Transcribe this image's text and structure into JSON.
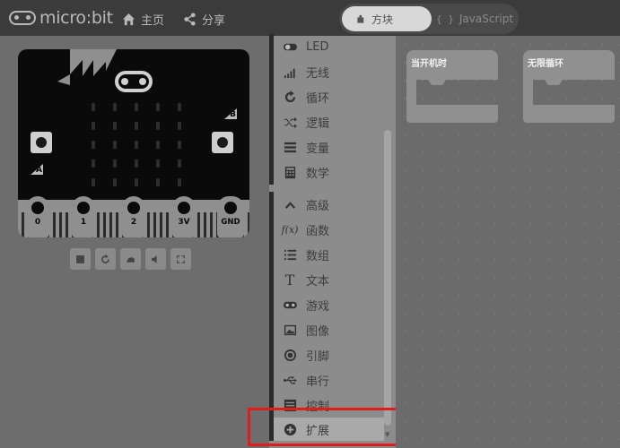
{
  "header": {
    "logo_text": "micro:bit",
    "nav": [
      {
        "label": "主页",
        "icon": "home-icon"
      },
      {
        "label": "分享",
        "icon": "share-icon"
      }
    ],
    "editor_tabs": [
      {
        "label": "方块",
        "icon": "puzzle-icon",
        "active": true
      },
      {
        "label": "JavaScript",
        "icon": "braces-icon",
        "active": false,
        "prefix": "{ }"
      }
    ]
  },
  "simulator": {
    "button_labels": {
      "a": "A",
      "b": "B"
    },
    "pins": [
      "0",
      "1",
      "2",
      "3V",
      "GND"
    ],
    "toolbar": [
      "stop-icon",
      "restart-icon",
      "slowmo-icon",
      "mute-icon",
      "fullscreen-icon"
    ]
  },
  "toolbox": {
    "categories": [
      {
        "label": "LED",
        "icon": "toggle-icon"
      },
      {
        "label": "无线",
        "icon": "signal-icon"
      },
      {
        "label": "循环",
        "icon": "refresh-icon"
      },
      {
        "label": "逻辑",
        "icon": "shuffle-icon"
      },
      {
        "label": "变量",
        "icon": "list-icon"
      },
      {
        "label": "数学",
        "icon": "calculator-icon"
      }
    ],
    "advanced_label": "高级",
    "advanced": [
      {
        "label": "函数",
        "icon": "function-icon"
      },
      {
        "label": "数组",
        "icon": "array-icon"
      },
      {
        "label": "文本",
        "icon": "text-icon"
      },
      {
        "label": "游戏",
        "icon": "gamepad-icon"
      },
      {
        "label": "图像",
        "icon": "image-icon"
      },
      {
        "label": "引脚",
        "icon": "pin-icon"
      },
      {
        "label": "串行",
        "icon": "usb-icon"
      },
      {
        "label": "控制",
        "icon": "control-icon"
      },
      {
        "label": "扩展",
        "icon": "add-circle-icon"
      }
    ]
  },
  "workspace": {
    "blocks": [
      {
        "label": "当开机时"
      },
      {
        "label": "无限循环"
      }
    ]
  },
  "colors": {
    "highlight": "#e21c1c",
    "header_bg": "#3b3b3b"
  }
}
